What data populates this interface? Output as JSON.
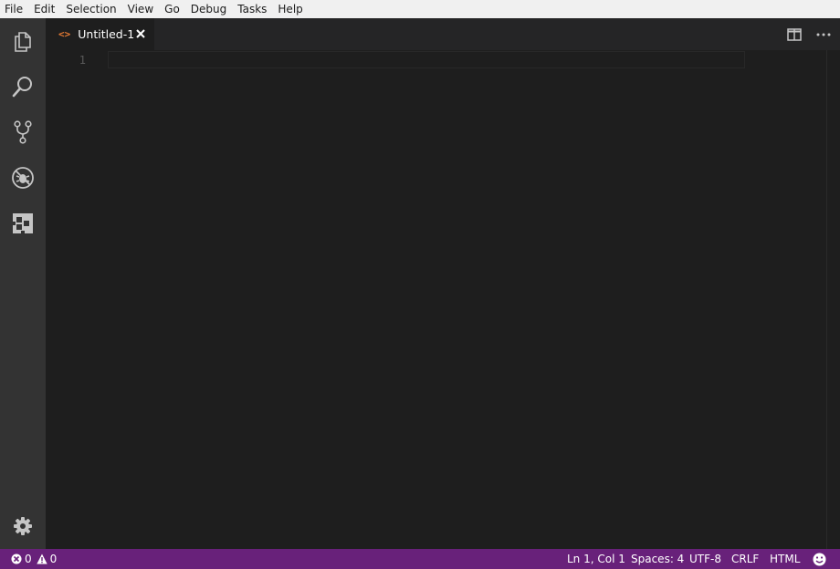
{
  "menubar": {
    "items": [
      "File",
      "Edit",
      "Selection",
      "View",
      "Go",
      "Debug",
      "Tasks",
      "Help"
    ]
  },
  "activitybar": {
    "icons": [
      "files-icon",
      "search-icon",
      "source-control-icon",
      "debug-icon",
      "extensions-icon",
      "gear-icon"
    ]
  },
  "tab": {
    "file_icon": "<>",
    "label": "Untitled-1",
    "icon_color": "#e37933"
  },
  "editor": {
    "line_numbers": [
      "1"
    ]
  },
  "statusbar": {
    "errors": "0",
    "warnings": "0",
    "position": "Ln 1, Col 1",
    "indent": "Spaces: 4",
    "encoding": "UTF-8",
    "eol": "CRLF",
    "language": "HTML",
    "color": "#68217a"
  },
  "colors": {
    "editor_bg": "#1e1e1e",
    "activitybar_bg": "#333333",
    "tabbar_bg": "#252526",
    "menubar_bg": "#f0f0f0"
  }
}
